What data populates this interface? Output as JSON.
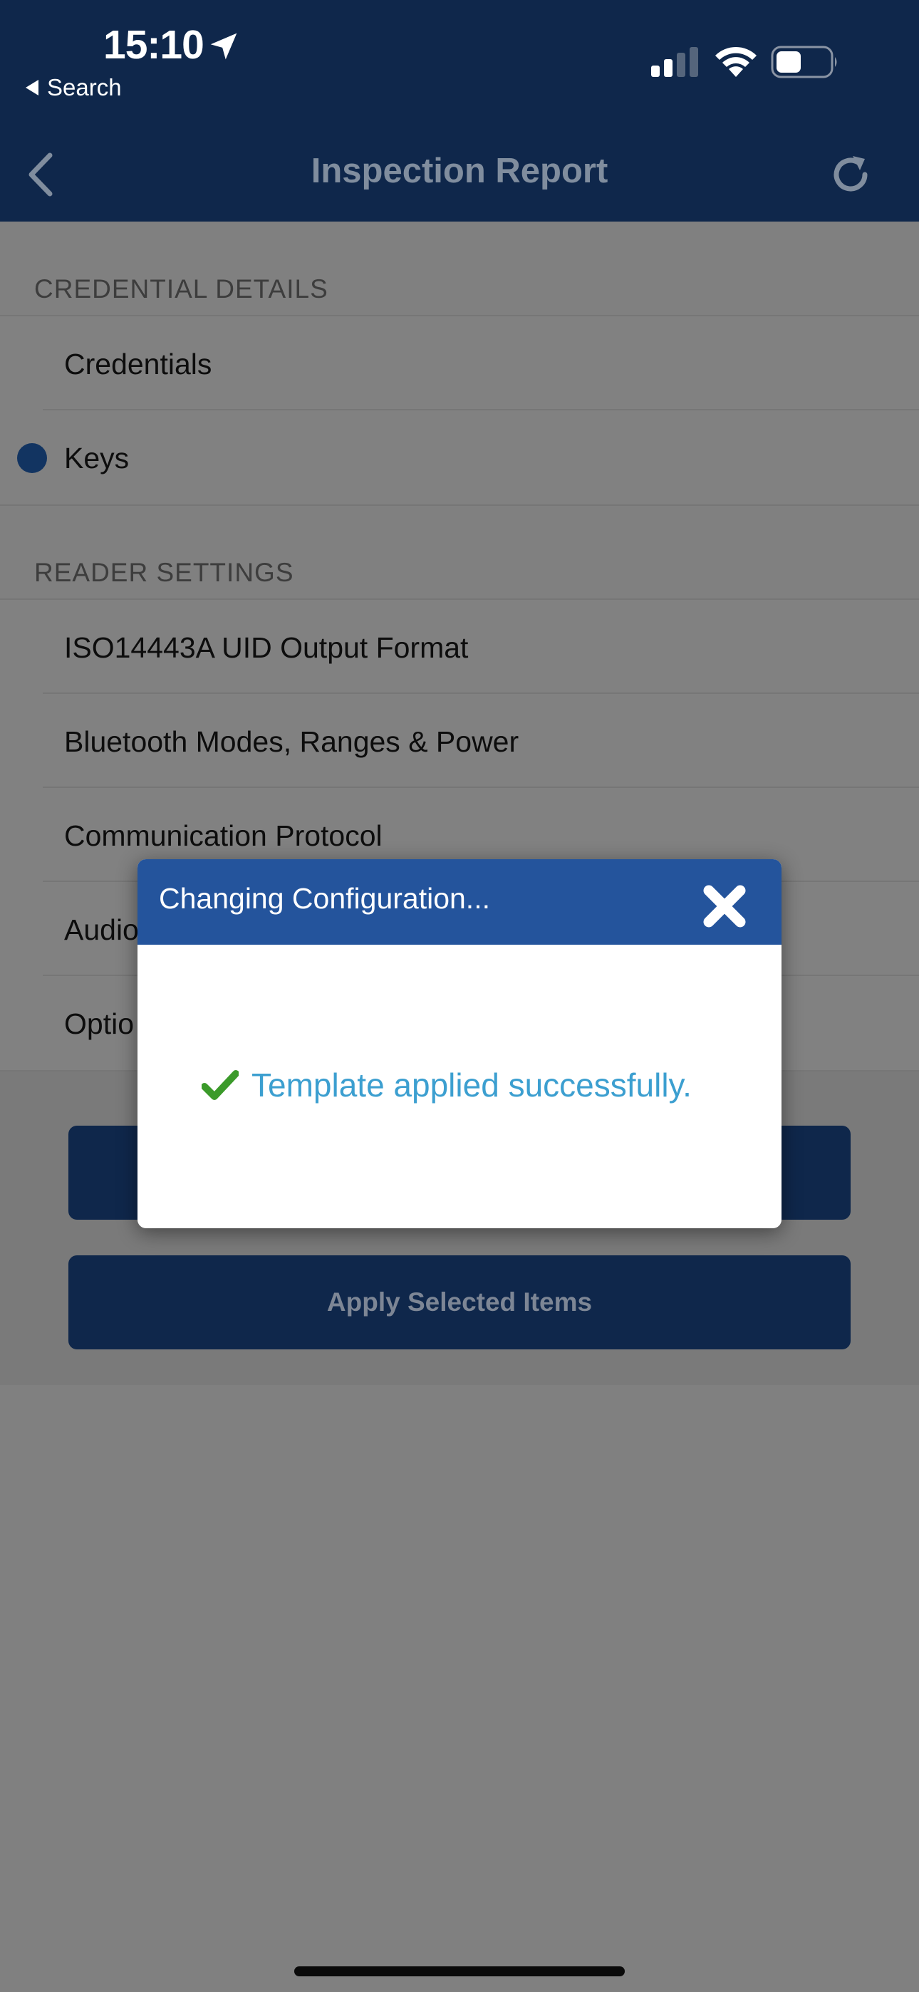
{
  "status_bar": {
    "time": "15:10",
    "back_app_label": "Search"
  },
  "nav": {
    "title": "Inspection Report"
  },
  "sections": [
    {
      "header": "CREDENTIAL DETAILS",
      "items": [
        {
          "label": "Credentials"
        },
        {
          "label": "Keys"
        }
      ]
    },
    {
      "header": "READER SETTINGS",
      "items": [
        {
          "label": "ISO14443A UID Output Format"
        },
        {
          "label": "Bluetooth Modes, Ranges & Power"
        },
        {
          "label": "Communication Protocol"
        },
        {
          "label": "Audio"
        },
        {
          "label": "Optio"
        }
      ]
    }
  ],
  "buttons": {
    "first_label": "",
    "apply_label": "Apply Selected Items"
  },
  "modal": {
    "title": "Changing Configuration...",
    "message": "Template applied successfully."
  },
  "colors": {
    "nav_bg": "#0f274b",
    "modal_header": "#24549c",
    "success_text": "#3c9fd0",
    "check_green": "#3b9a2a"
  },
  "icons": [
    "location-arrow-icon",
    "back-triangle-icon",
    "signal-icon",
    "wifi-icon",
    "battery-icon",
    "chevron-left-icon",
    "refresh-icon",
    "close-icon",
    "checkmark-icon"
  ]
}
